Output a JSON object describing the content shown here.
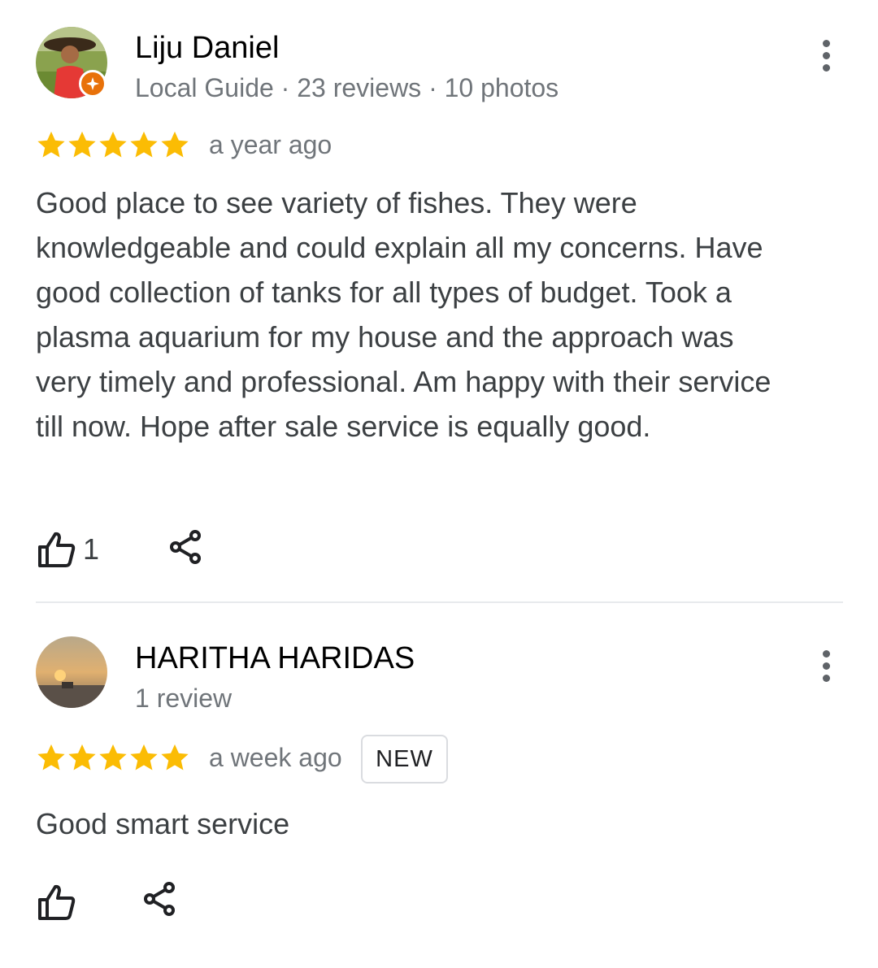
{
  "reviews": [
    {
      "name": "Liju Daniel",
      "meta": "Local Guide · 23 reviews · 10 photos",
      "rating": 5,
      "time": "a year ago",
      "text": "Good place to see variety of fishes. They were knowledgeable and could explain all my concerns. Have good collection of tanks for all types of budget. Took a plasma aquarium for my house and the approach was very timely and professional. Am happy with their service till now. Hope after sale service is equally good.",
      "likes": "1",
      "is_local_guide": true
    },
    {
      "name": "HARITHA HARIDAS",
      "meta": "1 review",
      "rating": 5,
      "time": "a week ago",
      "badge": "NEW",
      "text": "Good smart service",
      "likes": "",
      "is_local_guide": false
    }
  ],
  "colors": {
    "star": "#fbbc04",
    "guide_badge": "#e8710a",
    "secondary_text": "#70757a",
    "icon": "#202124"
  },
  "icons": {
    "like": "thumb-up-outline-icon",
    "share": "share-icon",
    "more": "more-vert-icon",
    "star": "star-icon",
    "guide": "local-guide-star-icon"
  }
}
